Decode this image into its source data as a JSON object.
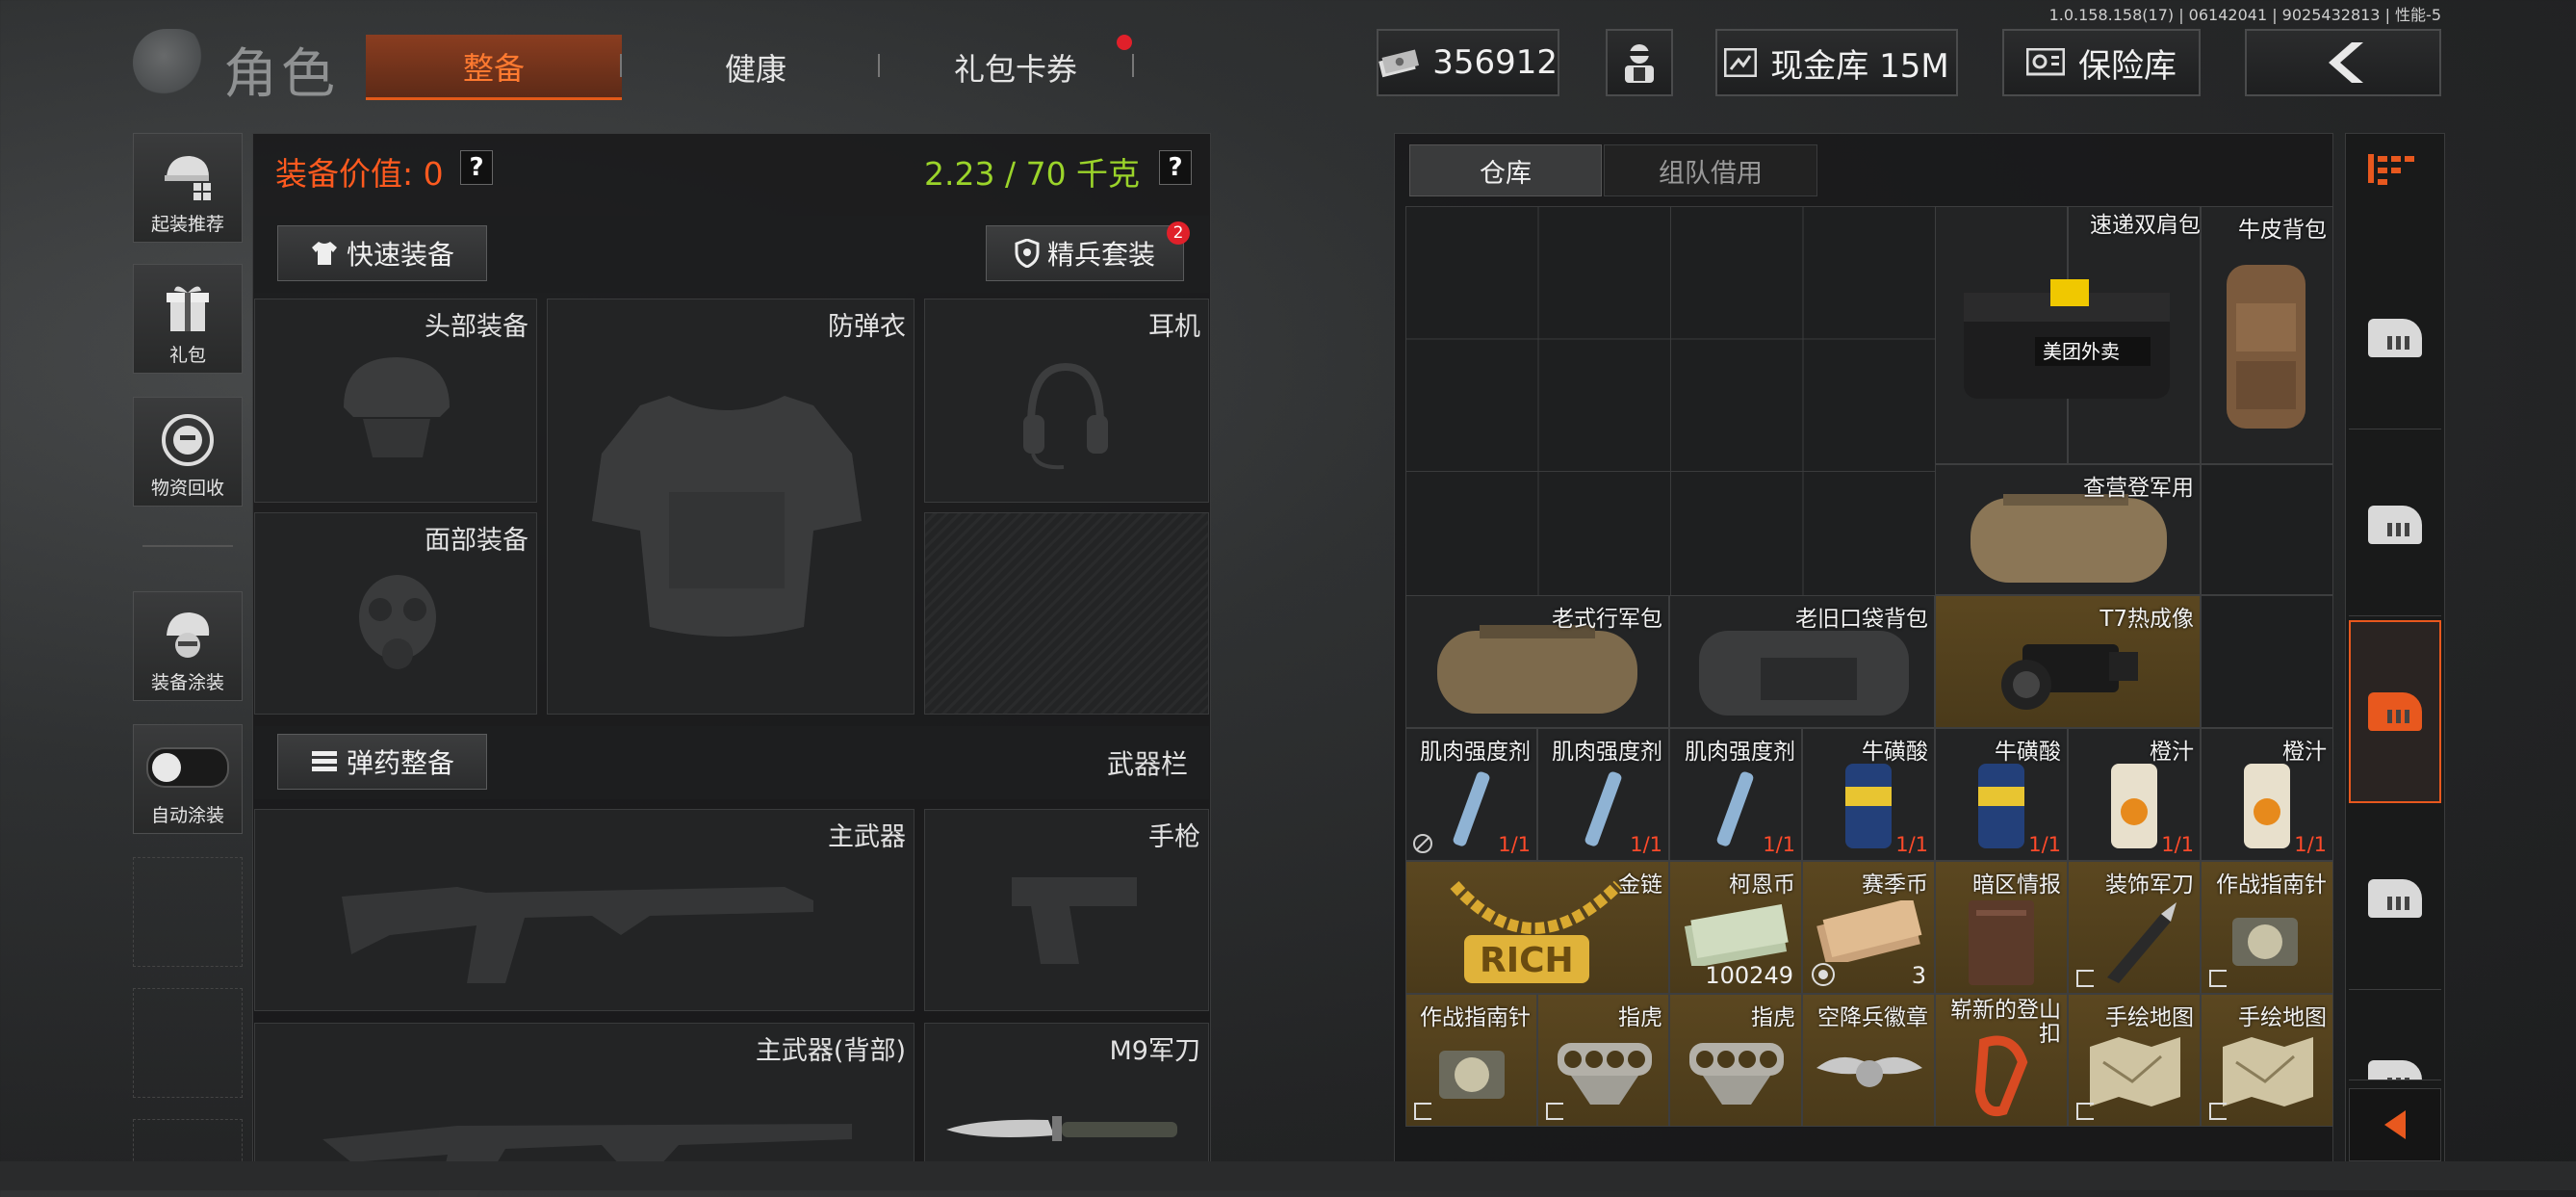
{
  "version_info": "1.0.158.158(17) | 06142041 | 9025432813 | 性能-5",
  "header": {
    "title": "角色",
    "tabs": [
      {
        "label": "整备",
        "active": true
      },
      {
        "label": "健康",
        "active": false
      },
      {
        "label": "礼包卡券",
        "active": false,
        "badge": "red-dot"
      }
    ],
    "currency": {
      "icon": "cash-stack-icon",
      "amount": "356912"
    },
    "buttons": {
      "agent_icon": "soldier-avatar-icon",
      "cash_vault": "现金库 15M",
      "safe": "保险库",
      "back_icon": "chevron-left-icon"
    }
  },
  "sidebar": [
    {
      "label": "起装推荐",
      "icon": "helmet-grid-icon"
    },
    {
      "label": "礼包",
      "icon": "gift-box-icon"
    },
    {
      "label": "物资回收",
      "icon": "recycle-face-icon"
    },
    {
      "label": "装备涂装",
      "icon": "helmet-paint-icon"
    },
    {
      "label": "自动涂装",
      "icon": "toggle-switch-icon",
      "toggle_on": false
    }
  ],
  "equipment": {
    "value_label": "装备价值: 0",
    "weight_label": "2.23 / 70 千克",
    "quick_equip": "快速装备",
    "elite_kit": "精兵套装",
    "elite_kit_badge": "2",
    "slots": {
      "head": "头部装备",
      "armor": "防弹衣",
      "headset": "耳机",
      "face": "面部装备"
    },
    "ammo_button": "弹药整备",
    "weapon_bar": "武器栏",
    "weapons": {
      "primary": "主武器",
      "pistol": "手枪",
      "primary_back": "主武器(背部)",
      "melee": "M9军刀"
    }
  },
  "warehouse": {
    "tabs": [
      "仓库",
      "组队借用"
    ],
    "active_tab": "仓库",
    "items": {
      "delivery_bag": {
        "name": "速递双肩包"
      },
      "leather_bag": {
        "name": "牛皮背包"
      },
      "army_bag": {
        "name": "查营登军用"
      },
      "old_bag": {
        "name": "老式行军包"
      },
      "pocket_bag": {
        "name": "老旧口袋背包"
      },
      "thermal": {
        "name": "T7热成像"
      },
      "muscle1": {
        "name": "肌肉强度剂",
        "count": "1/1"
      },
      "muscle2": {
        "name": "肌肉强度剂",
        "count": "1/1"
      },
      "muscle3": {
        "name": "肌肉强度剂",
        "count": "1/1"
      },
      "acid1": {
        "name": "牛磺酸",
        "count": "1/1"
      },
      "acid2": {
        "name": "牛磺酸",
        "count": "1/1"
      },
      "juice1": {
        "name": "橙汁",
        "count": "1/1"
      },
      "juice2": {
        "name": "橙汁",
        "count": "1/1"
      },
      "gold_chain": {
        "name": "金链",
        "text": "RICH"
      },
      "kn_coin": {
        "name": "柯恩币",
        "num": "100249"
      },
      "season_coin": {
        "name": "赛季币",
        "num": "3"
      },
      "dark_intel": {
        "name": "暗区情报"
      },
      "deco_knife": {
        "name": "装饰军刀"
      },
      "compass1": {
        "name": "作战指南针"
      },
      "compass2": {
        "name": "作战指南针"
      },
      "knuckle1": {
        "name": "指虎"
      },
      "knuckle2": {
        "name": "指虎"
      },
      "para_badge": {
        "name": "空降兵徽章"
      },
      "carabiner": {
        "name": "崭新的登山扣"
      },
      "map1": {
        "name": "手绘地图"
      },
      "map2": {
        "name": "手绘地图"
      }
    }
  },
  "rail": {
    "top_icon": "sort-list-icon",
    "items": [
      "shelf-icon",
      "shelf-icon",
      "shelf-icon-active",
      "shelf-icon",
      "shelf-icon"
    ],
    "collapse_icon": "chevron-left-icon"
  },
  "colors": {
    "accent": "#e8581e",
    "value_text": "#ff5a1f",
    "weight_text": "#9bd42a",
    "gold_cell": "#5b4720"
  }
}
